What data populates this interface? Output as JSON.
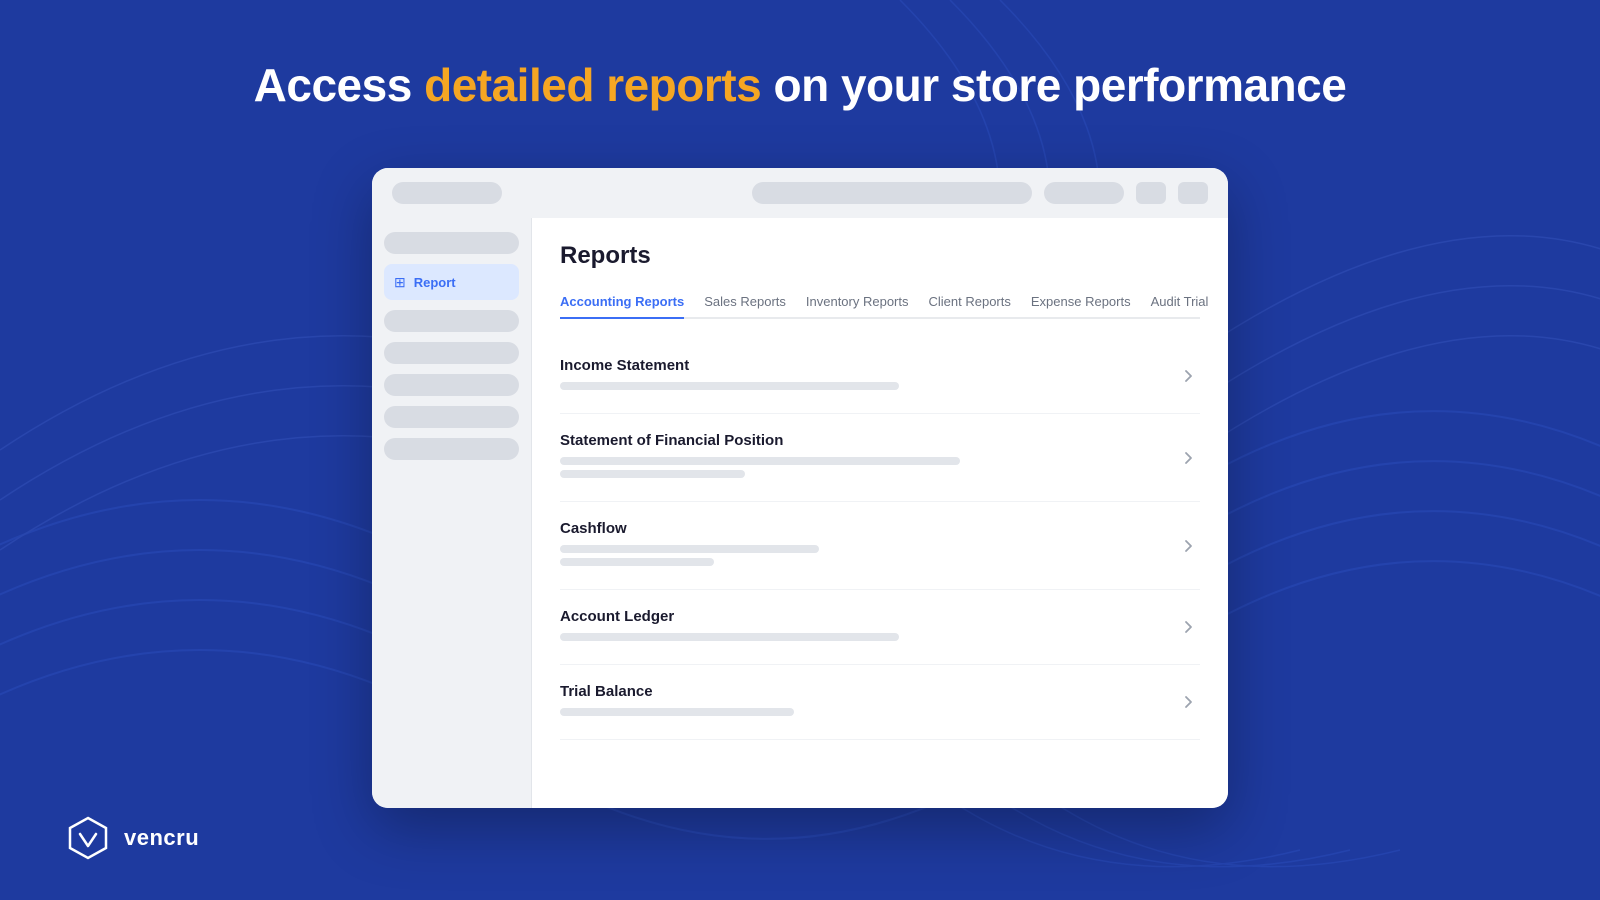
{
  "hero": {
    "prefix": "Access ",
    "highlight": "detailed reports",
    "suffix": " on your store performance"
  },
  "topbar": {
    "search_placeholder": "",
    "btn_label": ""
  },
  "sidebar": {
    "active_item_label": "Report",
    "placeholders": [
      "",
      "",
      "",
      "",
      ""
    ]
  },
  "main": {
    "page_title": "Reports",
    "tabs": [
      {
        "label": "Accounting Reports",
        "active": true
      },
      {
        "label": "Sales Reports",
        "active": false
      },
      {
        "label": "Inventory Reports",
        "active": false
      },
      {
        "label": "Client Reports",
        "active": false
      },
      {
        "label": "Expense Reports",
        "active": false
      },
      {
        "label": "Audit Trial",
        "active": false
      }
    ],
    "report_items": [
      {
        "title": "Income Statement"
      },
      {
        "title": "Statement of Financial Position"
      },
      {
        "title": "Cashflow"
      },
      {
        "title": "Account Ledger"
      },
      {
        "title": "Trial Balance"
      }
    ]
  },
  "logo": {
    "text": "vencru"
  }
}
